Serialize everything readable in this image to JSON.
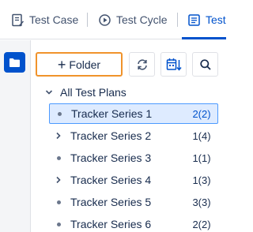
{
  "tabs": [
    {
      "label": "Test Case",
      "icon": "test-case-icon"
    },
    {
      "label": "Test Cycle",
      "icon": "test-cycle-icon"
    },
    {
      "label": "Test",
      "icon": "test-plan-icon",
      "active": true
    }
  ],
  "rail": {
    "icon": "folder-icon"
  },
  "toolbar": {
    "add_folder_label": "Folder",
    "add_icon": "plus-icon",
    "refresh_icon": "refresh-icon",
    "sort_icon": "calendar-sort-icon",
    "search_icon": "search-icon"
  },
  "tree": {
    "root_label": "All Test Plans",
    "items": [
      {
        "label": "Tracker Series 1",
        "count": "2(2)",
        "expandable": false,
        "selected": true
      },
      {
        "label": "Tracker Series 2",
        "count": "1(4)",
        "expandable": true
      },
      {
        "label": "Tracker Series 3",
        "count": "1(1)",
        "expandable": false
      },
      {
        "label": "Tracker Series 4",
        "count": "1(3)",
        "expandable": true
      },
      {
        "label": "Tracker Series 5",
        "count": "3(3)",
        "expandable": false
      },
      {
        "label": "Tracker Series 6",
        "count": "2(2)",
        "expandable": false
      }
    ]
  },
  "colors": {
    "accent": "#0052cc",
    "highlight": "#f0932b",
    "selected_bg": "#deebff"
  }
}
